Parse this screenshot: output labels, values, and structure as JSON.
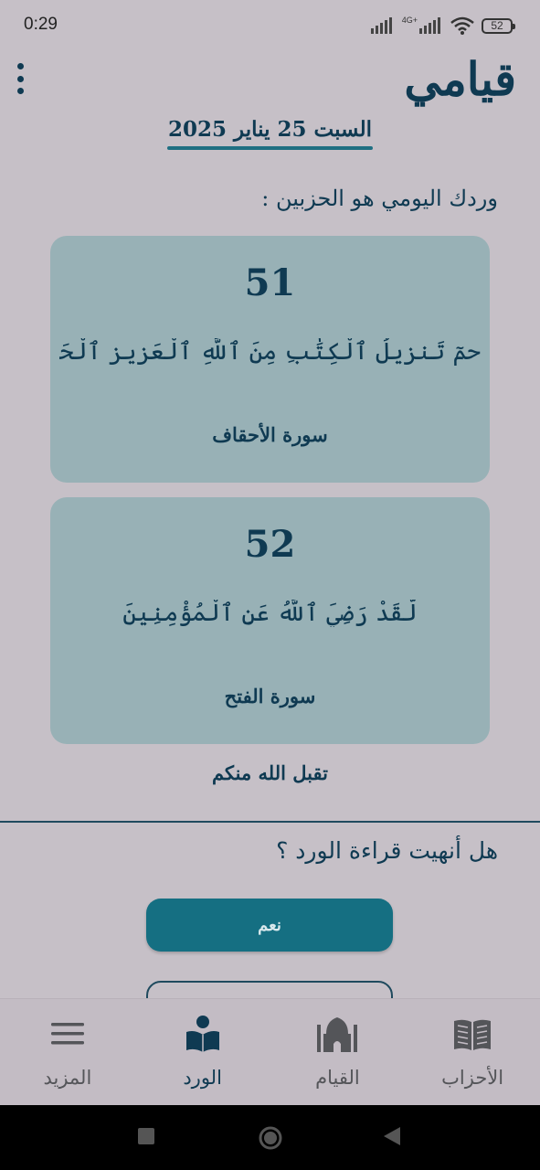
{
  "status_bar": {
    "time": "0:29",
    "network": "4G+",
    "battery": "52"
  },
  "header": {
    "app_title": "قيامي",
    "menu_icon": "more-vert-icon",
    "date": "السبت 25 يناير 2025"
  },
  "daily": {
    "intro": "وردك اليومي هو الحزبين :",
    "hizbs": [
      {
        "number": "51",
        "verse": "حمٓ تَنزِيلُ ٱلْكِتَٰبِ مِنَ ٱللَّهِ ٱلْعَزِيزِ ٱلْحَكِيمِ",
        "surah": "سورة الأحقاف"
      },
      {
        "number": "52",
        "verse": "لَّقَدْ رَضِيَ ٱللَّهُ عَنِ ٱلْمُؤْمِنِينَ",
        "surah": "سورة الفتح"
      }
    ],
    "blessing": "تقبل الله منكم"
  },
  "completion": {
    "question": "هل أنهيت قراءة الورد ؟",
    "yes_label": "نعم"
  },
  "bottom_nav": [
    {
      "label": "الأحزاب",
      "icon": "book-icon",
      "active": false
    },
    {
      "label": "القيام",
      "icon": "mosque-icon",
      "active": false
    },
    {
      "label": "الورد",
      "icon": "quran-reader-icon",
      "active": true
    },
    {
      "label": "المزيد",
      "icon": "hamburger-menu-icon",
      "active": false
    }
  ],
  "colors": {
    "background": "#c6c0c7",
    "primary": "#0f3a52",
    "accent": "#156f82",
    "card": "#98b1b6"
  }
}
